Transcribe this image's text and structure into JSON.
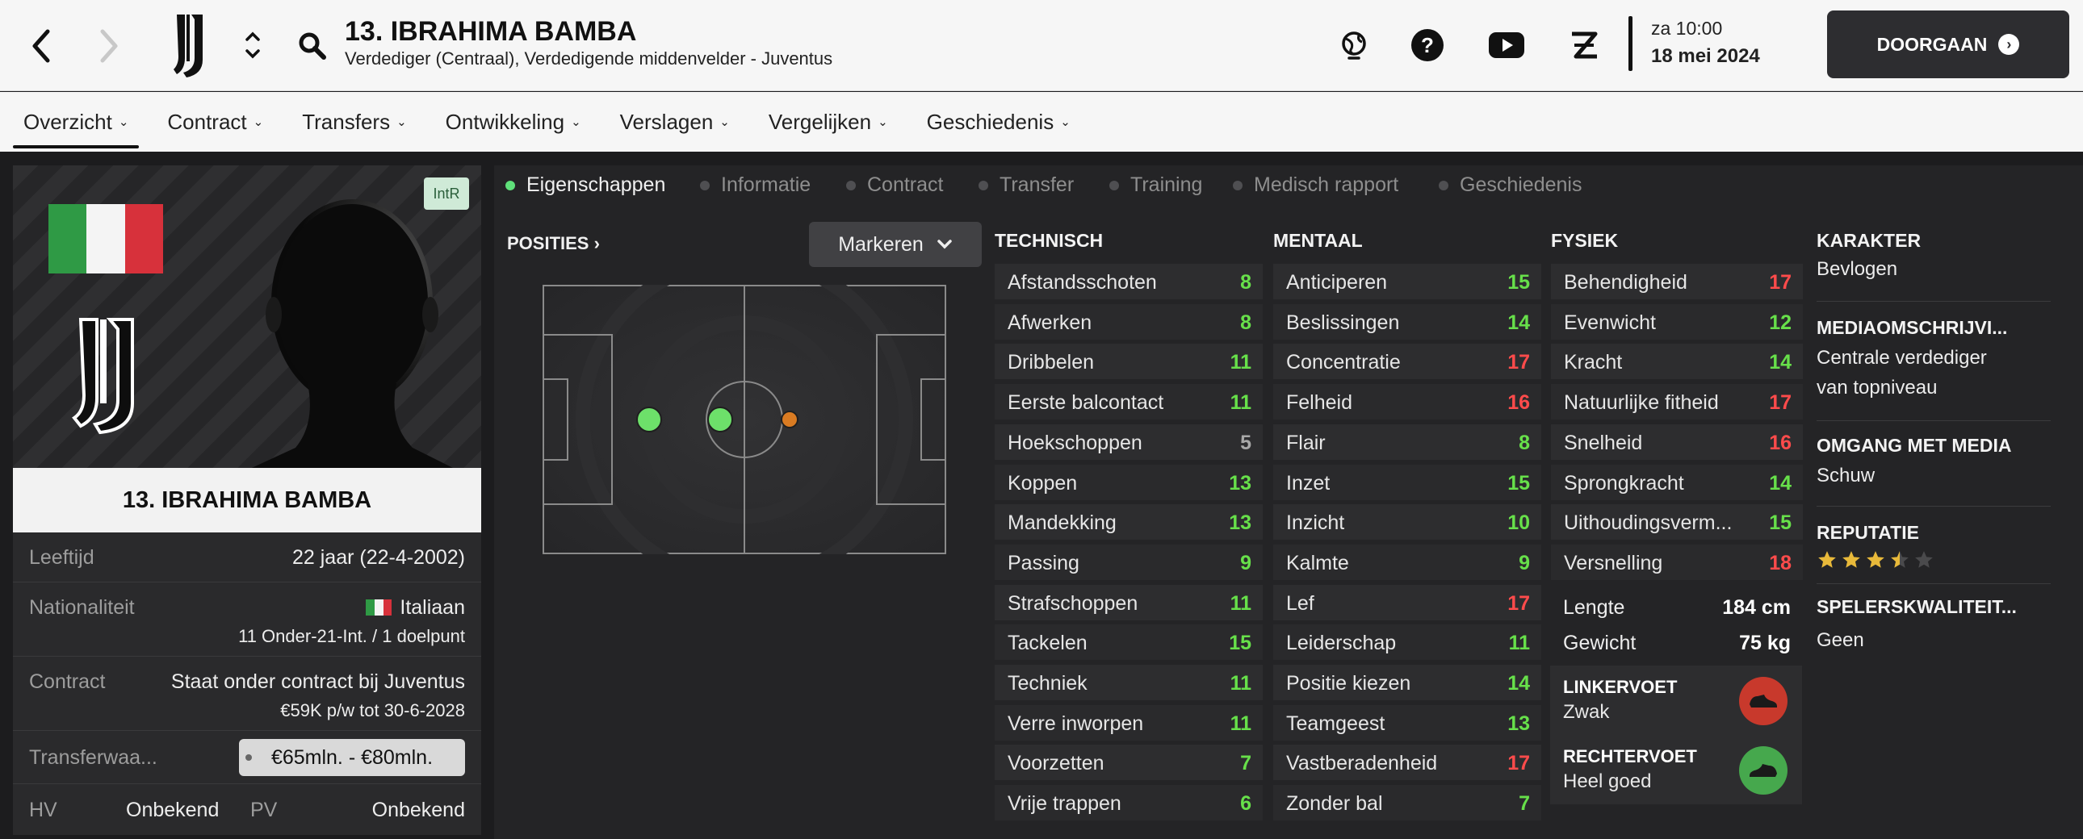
{
  "header": {
    "title": "13. IBRAHIMA BAMBA",
    "subtitle": "Verdediger (Centraal), Verdedigende middenvelder - Juventus",
    "time": "za 10:00",
    "date": "18 mei 2024",
    "continue_label": "DOORGAAN"
  },
  "tabs": [
    {
      "label": "Overzicht",
      "active": true
    },
    {
      "label": "Contract"
    },
    {
      "label": "Transfers"
    },
    {
      "label": "Ontwikkeling"
    },
    {
      "label": "Verslagen"
    },
    {
      "label": "Vergelijken"
    },
    {
      "label": "Geschiedenis"
    }
  ],
  "profile": {
    "badge": "IntR",
    "name": "13. IBRAHIMA BAMBA",
    "age_label": "Leeftijd",
    "age_value": "22 jaar (22-4-2002)",
    "nationality_label": "Nationaliteit",
    "nationality_value": "Italiaan",
    "nationality_caps": "11 Onder-21-Int. / 1 doelpunt",
    "contract_label": "Contract",
    "contract_value": "Staat onder contract bij Juventus",
    "contract_wage": "€59K p/w tot 30-6-2028",
    "transfer_label": "Transferwaa...",
    "transfer_value": "€65mln. - €80mln.",
    "hv_label": "HV",
    "hv_value": "Onbekend",
    "pv_label": "PV",
    "pv_value": "Onbekend"
  },
  "subtabs": [
    {
      "label": "Eigenschappen",
      "active": true
    },
    {
      "label": "Informatie"
    },
    {
      "label": "Contract"
    },
    {
      "label": "Transfer"
    },
    {
      "label": "Training"
    },
    {
      "label": "Medisch rapport"
    },
    {
      "label": "Geschiedenis"
    }
  ],
  "positions_label": "POSITIES",
  "highlight_select": "Markeren",
  "columns": {
    "technisch": {
      "title": "TECHNISCH",
      "attrs": [
        {
          "name": "Afstandsschoten",
          "value": "8"
        },
        {
          "name": "Afwerken",
          "value": "8"
        },
        {
          "name": "Dribbelen",
          "value": "11"
        },
        {
          "name": "Eerste balcontact",
          "value": "11"
        },
        {
          "name": "Hoekschoppen",
          "value": "5"
        },
        {
          "name": "Koppen",
          "value": "13"
        },
        {
          "name": "Mandekking",
          "value": "13"
        },
        {
          "name": "Passing",
          "value": "9"
        },
        {
          "name": "Strafschoppen",
          "value": "11"
        },
        {
          "name": "Tackelen",
          "value": "15"
        },
        {
          "name": "Techniek",
          "value": "11"
        },
        {
          "name": "Verre inworpen",
          "value": "11"
        },
        {
          "name": "Voorzetten",
          "value": "7"
        },
        {
          "name": "Vrije trappen",
          "value": "6"
        }
      ]
    },
    "mentaal": {
      "title": "MENTAAL",
      "attrs": [
        {
          "name": "Anticiperen",
          "value": "15"
        },
        {
          "name": "Beslissingen",
          "value": "14"
        },
        {
          "name": "Concentratie",
          "value": "17"
        },
        {
          "name": "Felheid",
          "value": "16"
        },
        {
          "name": "Flair",
          "value": "8"
        },
        {
          "name": "Inzet",
          "value": "15"
        },
        {
          "name": "Inzicht",
          "value": "10"
        },
        {
          "name": "Kalmte",
          "value": "9"
        },
        {
          "name": "Lef",
          "value": "17"
        },
        {
          "name": "Leiderschap",
          "value": "11"
        },
        {
          "name": "Positie kiezen",
          "value": "14"
        },
        {
          "name": "Teamgeest",
          "value": "13"
        },
        {
          "name": "Vastberadenheid",
          "value": "17"
        },
        {
          "name": "Zonder bal",
          "value": "7"
        }
      ]
    },
    "fysiek": {
      "title": "FYSIEK",
      "attrs": [
        {
          "name": "Behendigheid",
          "value": "17"
        },
        {
          "name": "Evenwicht",
          "value": "12"
        },
        {
          "name": "Kracht",
          "value": "14"
        },
        {
          "name": "Natuurlijke fitheid",
          "value": "17"
        },
        {
          "name": "Snelheid",
          "value": "16"
        },
        {
          "name": "Sprongkracht",
          "value": "14"
        },
        {
          "name": "Uithoudingsverm...",
          "value": "15"
        },
        {
          "name": "Versnelling",
          "value": "18"
        }
      ],
      "height_label": "Lengte",
      "height_value": "184 cm",
      "weight_label": "Gewicht",
      "weight_value": "75 kg",
      "left_foot_label": "LINKERVOET",
      "left_foot_value": "Zwak",
      "right_foot_label": "RECHTERVOET",
      "right_foot_value": "Heel goed"
    }
  },
  "info": {
    "karakter_label": "KARAKTER",
    "karakter_value": "Bevlogen",
    "media_desc_label": "MEDIAOMSCHRIJVI...",
    "media_desc_line1": "Centrale verdediger",
    "media_desc_line2": "van topniveau",
    "media_handling_label": "OMGANG MET MEDIA",
    "media_handling_value": "Schuw",
    "reputation_label": "REPUTATIE",
    "reputation_stars": 3.5,
    "qualities_label": "SPELERSKWALITEIT...",
    "qualities_value": "Geen"
  },
  "colors": {
    "good": "#67e04a",
    "bad": "#ff4b4b",
    "neutral": "#a8a8a8",
    "accent": "#5fe07a"
  }
}
